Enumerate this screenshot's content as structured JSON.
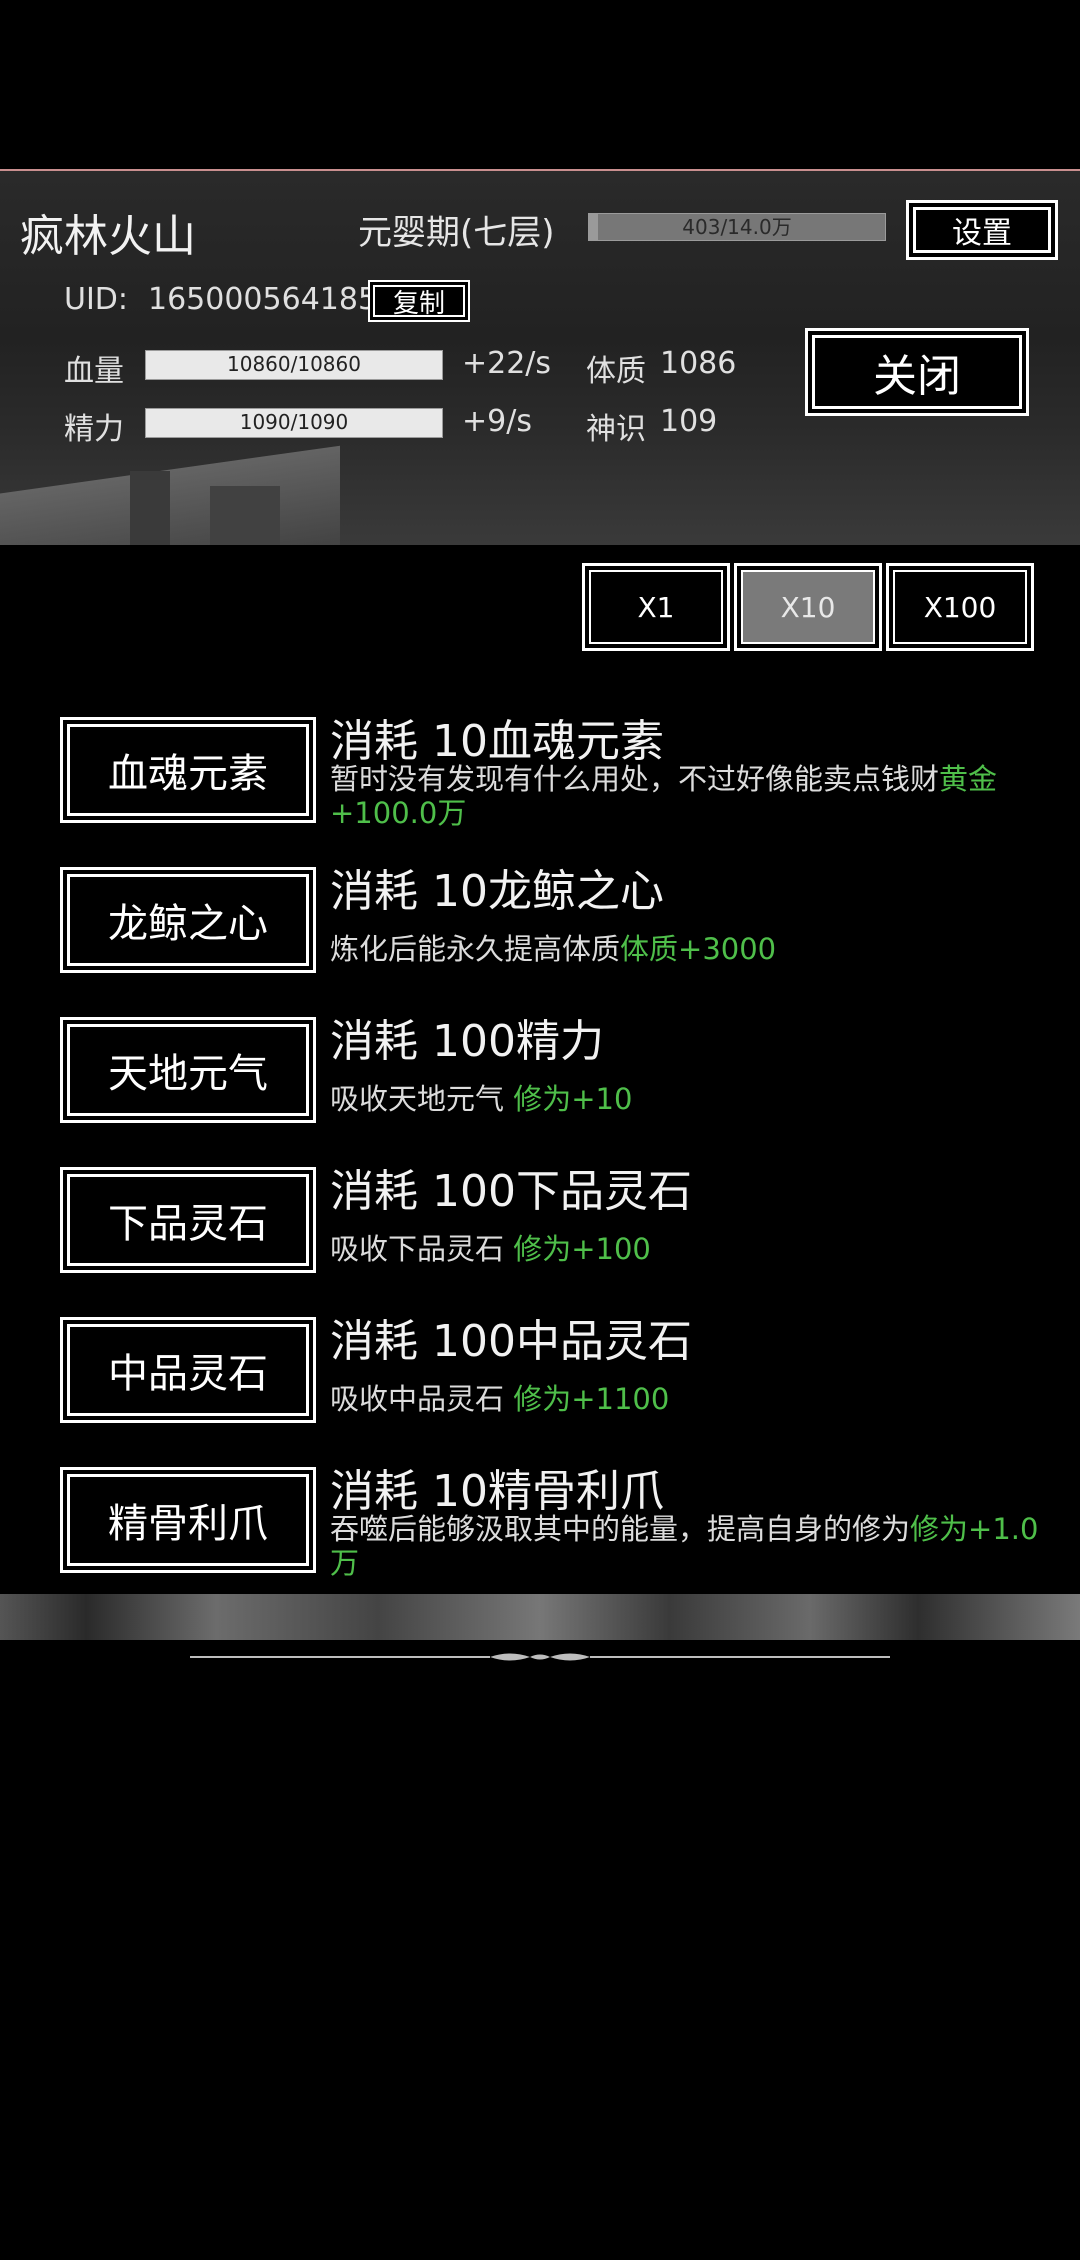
{
  "player": {
    "name": "疯林火山",
    "realm": "元婴期(七层)",
    "cultivation_text": "403/14.0万",
    "cultivation_progress": 0.03,
    "uid_label": "UID:",
    "uid": "165000564185",
    "copy_label": "复制",
    "settings_label": "设置",
    "close_label": "关闭"
  },
  "stats": {
    "hp_label": "血量",
    "hp_text": "10860/10860",
    "hp_progress": 1.0,
    "hp_regen": "+22/s",
    "mp_label": "精力",
    "mp_text": "1090/1090",
    "mp_progress": 1.0,
    "mp_regen": "+9/s",
    "con_label": "体质",
    "con_value": "1086",
    "spirit_label": "神识",
    "spirit_value": "109"
  },
  "multipliers": {
    "x1": "X1",
    "x10": "X10",
    "x100": "X100",
    "active": "X10"
  },
  "items": [
    {
      "button": "血魂元素",
      "title": "消耗 10血魂元素",
      "desc": "暂时没有发现有什么用处，不过好像能卖点钱财",
      "reward": "黄金+100.0万"
    },
    {
      "button": "龙鲸之心",
      "title": "消耗 10龙鲸之心",
      "desc": "炼化后能永久提高体质",
      "reward": "体质+3000"
    },
    {
      "button": "天地元气",
      "title": "消耗 100精力",
      "desc": "吸收天地元气 ",
      "reward": "修为+10"
    },
    {
      "button": "下品灵石",
      "title": "消耗 100下品灵石",
      "desc": "吸收下品灵石 ",
      "reward": "修为+100"
    },
    {
      "button": "中品灵石",
      "title": "消耗 100中品灵石",
      "desc": "吸收中品灵石 ",
      "reward": "修为+1100"
    },
    {
      "button": "精骨利爪",
      "title": "消耗 10精骨利爪",
      "desc": "吞噬后能够汲取其中的能量，提高自身的修为",
      "reward": "修为+1.0万"
    }
  ],
  "colors": {
    "background": "#000000",
    "reward_green": "#4fbf4a",
    "header_line": "#c98f8f",
    "active_multiplier": "#7a7a7a"
  }
}
